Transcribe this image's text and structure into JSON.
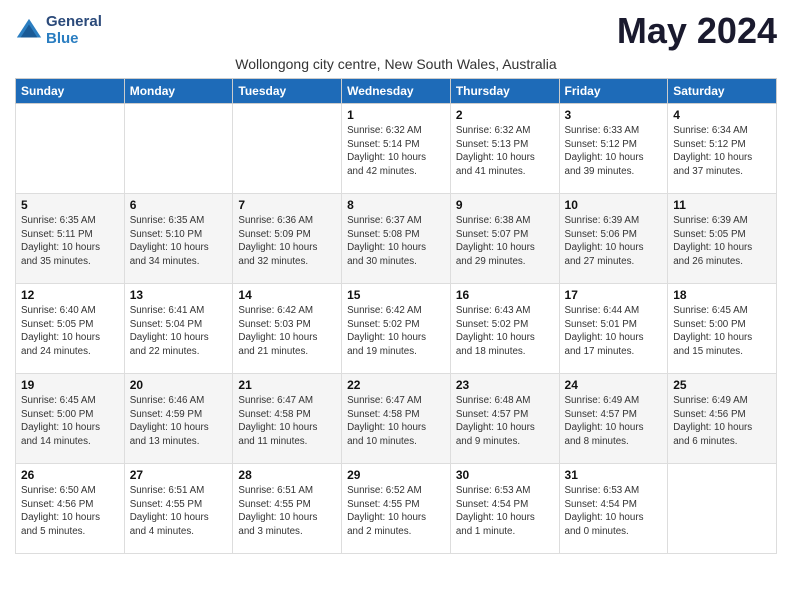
{
  "logo": {
    "general": "General",
    "blue": "Blue"
  },
  "title": "May 2024",
  "location": "Wollongong city centre, New South Wales, Australia",
  "days_of_week": [
    "Sunday",
    "Monday",
    "Tuesday",
    "Wednesday",
    "Thursday",
    "Friday",
    "Saturday"
  ],
  "weeks": [
    [
      {
        "day": "",
        "info": ""
      },
      {
        "day": "",
        "info": ""
      },
      {
        "day": "",
        "info": ""
      },
      {
        "day": "1",
        "info": "Sunrise: 6:32 AM\nSunset: 5:14 PM\nDaylight: 10 hours and 42 minutes."
      },
      {
        "day": "2",
        "info": "Sunrise: 6:32 AM\nSunset: 5:13 PM\nDaylight: 10 hours and 41 minutes."
      },
      {
        "day": "3",
        "info": "Sunrise: 6:33 AM\nSunset: 5:12 PM\nDaylight: 10 hours and 39 minutes."
      },
      {
        "day": "4",
        "info": "Sunrise: 6:34 AM\nSunset: 5:12 PM\nDaylight: 10 hours and 37 minutes."
      }
    ],
    [
      {
        "day": "5",
        "info": "Sunrise: 6:35 AM\nSunset: 5:11 PM\nDaylight: 10 hours and 35 minutes."
      },
      {
        "day": "6",
        "info": "Sunrise: 6:35 AM\nSunset: 5:10 PM\nDaylight: 10 hours and 34 minutes."
      },
      {
        "day": "7",
        "info": "Sunrise: 6:36 AM\nSunset: 5:09 PM\nDaylight: 10 hours and 32 minutes."
      },
      {
        "day": "8",
        "info": "Sunrise: 6:37 AM\nSunset: 5:08 PM\nDaylight: 10 hours and 30 minutes."
      },
      {
        "day": "9",
        "info": "Sunrise: 6:38 AM\nSunset: 5:07 PM\nDaylight: 10 hours and 29 minutes."
      },
      {
        "day": "10",
        "info": "Sunrise: 6:39 AM\nSunset: 5:06 PM\nDaylight: 10 hours and 27 minutes."
      },
      {
        "day": "11",
        "info": "Sunrise: 6:39 AM\nSunset: 5:05 PM\nDaylight: 10 hours and 26 minutes."
      }
    ],
    [
      {
        "day": "12",
        "info": "Sunrise: 6:40 AM\nSunset: 5:05 PM\nDaylight: 10 hours and 24 minutes."
      },
      {
        "day": "13",
        "info": "Sunrise: 6:41 AM\nSunset: 5:04 PM\nDaylight: 10 hours and 22 minutes."
      },
      {
        "day": "14",
        "info": "Sunrise: 6:42 AM\nSunset: 5:03 PM\nDaylight: 10 hours and 21 minutes."
      },
      {
        "day": "15",
        "info": "Sunrise: 6:42 AM\nSunset: 5:02 PM\nDaylight: 10 hours and 19 minutes."
      },
      {
        "day": "16",
        "info": "Sunrise: 6:43 AM\nSunset: 5:02 PM\nDaylight: 10 hours and 18 minutes."
      },
      {
        "day": "17",
        "info": "Sunrise: 6:44 AM\nSunset: 5:01 PM\nDaylight: 10 hours and 17 minutes."
      },
      {
        "day": "18",
        "info": "Sunrise: 6:45 AM\nSunset: 5:00 PM\nDaylight: 10 hours and 15 minutes."
      }
    ],
    [
      {
        "day": "19",
        "info": "Sunrise: 6:45 AM\nSunset: 5:00 PM\nDaylight: 10 hours and 14 minutes."
      },
      {
        "day": "20",
        "info": "Sunrise: 6:46 AM\nSunset: 4:59 PM\nDaylight: 10 hours and 13 minutes."
      },
      {
        "day": "21",
        "info": "Sunrise: 6:47 AM\nSunset: 4:58 PM\nDaylight: 10 hours and 11 minutes."
      },
      {
        "day": "22",
        "info": "Sunrise: 6:47 AM\nSunset: 4:58 PM\nDaylight: 10 hours and 10 minutes."
      },
      {
        "day": "23",
        "info": "Sunrise: 6:48 AM\nSunset: 4:57 PM\nDaylight: 10 hours and 9 minutes."
      },
      {
        "day": "24",
        "info": "Sunrise: 6:49 AM\nSunset: 4:57 PM\nDaylight: 10 hours and 8 minutes."
      },
      {
        "day": "25",
        "info": "Sunrise: 6:49 AM\nSunset: 4:56 PM\nDaylight: 10 hours and 6 minutes."
      }
    ],
    [
      {
        "day": "26",
        "info": "Sunrise: 6:50 AM\nSunset: 4:56 PM\nDaylight: 10 hours and 5 minutes."
      },
      {
        "day": "27",
        "info": "Sunrise: 6:51 AM\nSunset: 4:55 PM\nDaylight: 10 hours and 4 minutes."
      },
      {
        "day": "28",
        "info": "Sunrise: 6:51 AM\nSunset: 4:55 PM\nDaylight: 10 hours and 3 minutes."
      },
      {
        "day": "29",
        "info": "Sunrise: 6:52 AM\nSunset: 4:55 PM\nDaylight: 10 hours and 2 minutes."
      },
      {
        "day": "30",
        "info": "Sunrise: 6:53 AM\nSunset: 4:54 PM\nDaylight: 10 hours and 1 minute."
      },
      {
        "day": "31",
        "info": "Sunrise: 6:53 AM\nSunset: 4:54 PM\nDaylight: 10 hours and 0 minutes."
      },
      {
        "day": "",
        "info": ""
      }
    ]
  ]
}
